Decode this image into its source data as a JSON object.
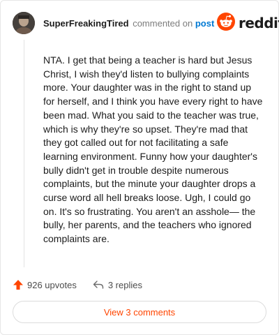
{
  "comment": {
    "username": "SuperFreakingTired",
    "action_text": "commented on",
    "post_link": "post",
    "body": "NTA. I get that being a teacher is hard but Jesus Christ, I wish they'd listen to bullying complaints more. Your daughter was in the right to stand up for herself, and I think you have every right to have been mad. What you said to the teacher was true, which is why they're so upset. They're mad that they got called out for not facilitating a safe learning environment. Funny how your daughter's bully didn't get in trouble despite numerous complaints, but the minute your daughter drops a curse word all hell breaks loose. Ugh, I could go on. It's so frustrating. You aren't an asshole— the bully, her parents, and the teachers who ignored complaints are.",
    "upvotes": "926 upvotes",
    "replies": "3 replies",
    "view_comments": "View 3 comments"
  },
  "brand": {
    "wordmark": "reddit",
    "accent_color": "#ff4500",
    "link_color": "#0079d3"
  },
  "icons": {
    "avatar": "avatar",
    "logo": "reddit-logo-icon",
    "upvote": "upvote-arrow-icon",
    "reply": "reply-arrow-icon"
  }
}
